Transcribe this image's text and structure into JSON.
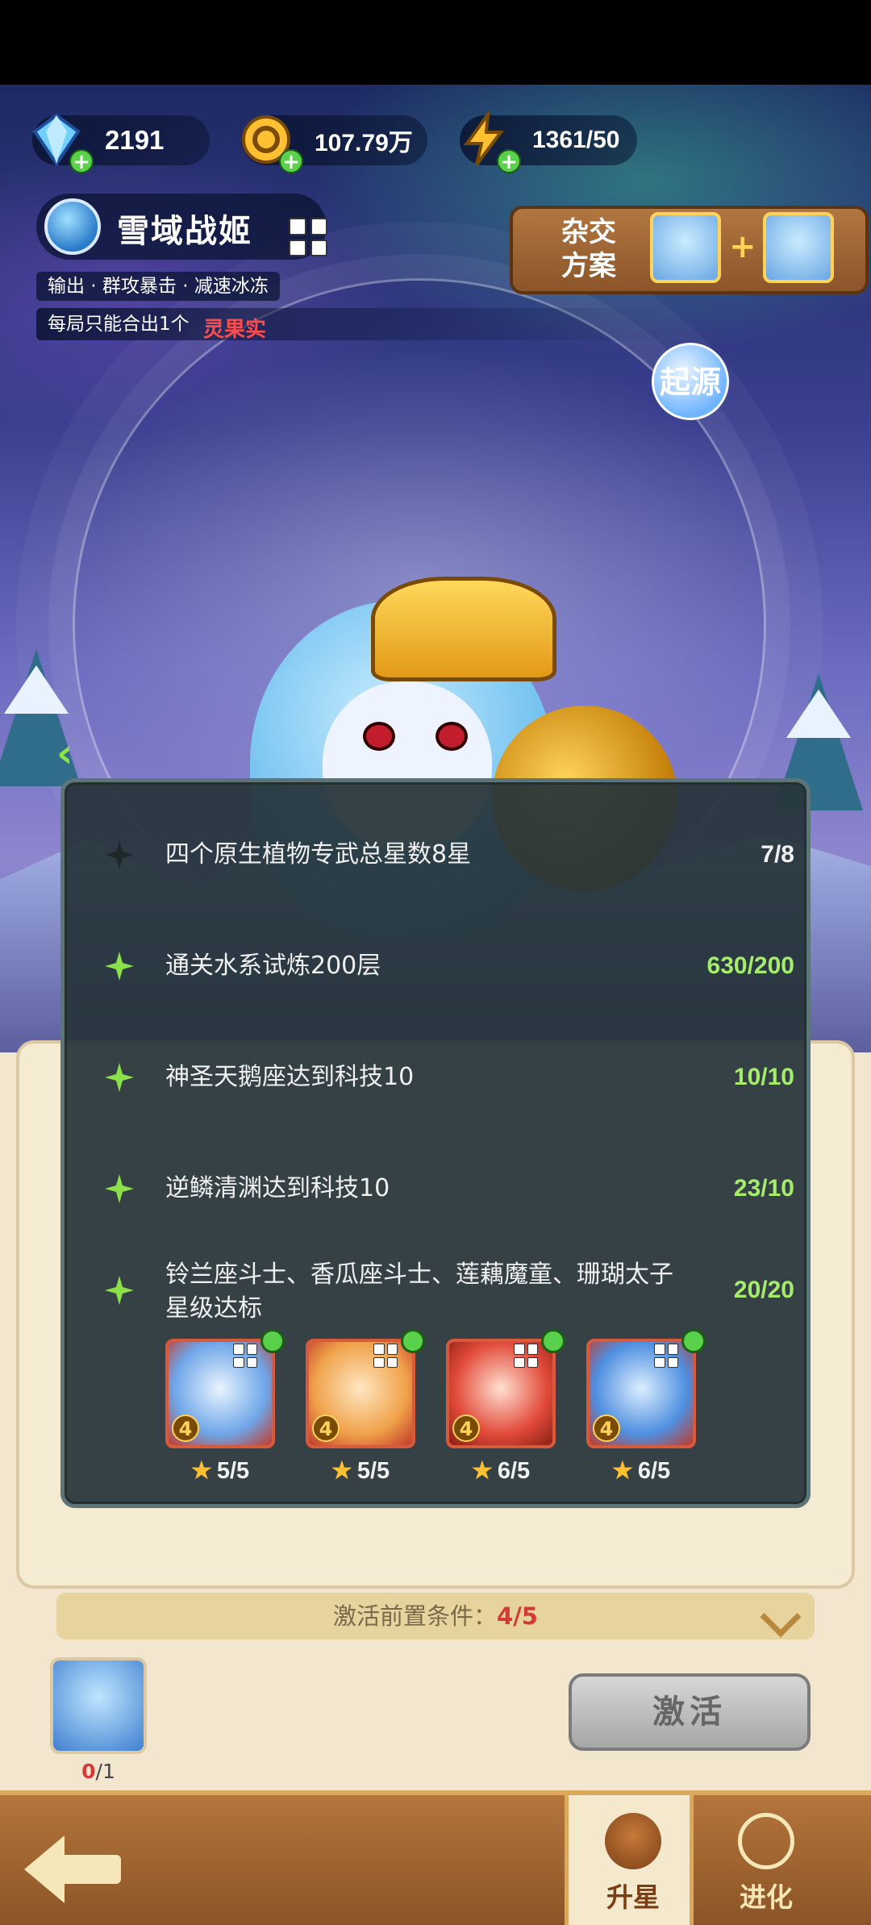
{
  "currency": {
    "gems": "2191",
    "gold": "107.79万",
    "energy": "1361/50"
  },
  "character": {
    "name": "雪域战姬",
    "tags": "输出 · 群攻暴击 · 减速冰冻",
    "tip_prefix": "每局只能合出1个",
    "tip_highlight": "灵果实"
  },
  "hybrid": {
    "label_line1": "杂交",
    "label_line2": "方案",
    "plus": "+"
  },
  "origin_label": "起源",
  "popup": {
    "conditions": [
      {
        "text": "四个原生植物专武总星数8星",
        "progress": "7/8",
        "completed": false
      },
      {
        "text": "通关水系试炼200层",
        "progress": "630/200",
        "completed": true
      },
      {
        "text": "神圣天鹅座达到科技10",
        "progress": "10/10",
        "completed": true
      },
      {
        "text": "逆鳞清渊达到科技10",
        "progress": "23/10",
        "completed": true
      },
      {
        "text": "铃兰座斗士、香瓜座斗士、莲藕魔童、珊瑚太子星级达标",
        "progress": "20/20",
        "completed": true
      }
    ],
    "heroes": [
      {
        "stars": "4",
        "progress": "5/5"
      },
      {
        "stars": "4",
        "progress": "5/5"
      },
      {
        "stars": "4",
        "progress": "6/5"
      },
      {
        "stars": "4",
        "progress": "6/5"
      }
    ]
  },
  "prerequisite": {
    "label": "激活前置条件：",
    "count": "4/5"
  },
  "fragments": {
    "owned": "0",
    "total": "/1"
  },
  "activate_label": "激活",
  "nav": {
    "star_up": "升星",
    "evolve": "进化"
  },
  "colors": {
    "completed": "#a6ec6c",
    "pending": "#f0f0f0",
    "warning": "#d43a3a"
  }
}
